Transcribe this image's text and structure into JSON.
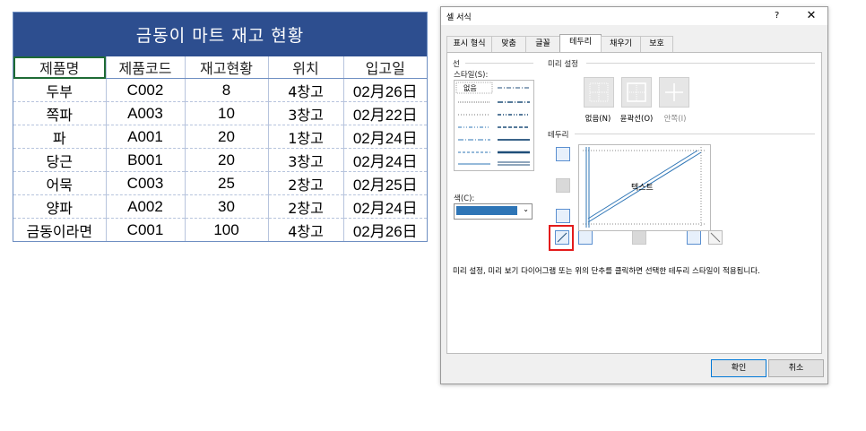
{
  "sheet": {
    "title": "금동이 마트 재고 현황",
    "headers": [
      "제품명",
      "제품코드",
      "재고현황",
      "위치",
      "입고일"
    ],
    "rows": [
      [
        "두부",
        "C002",
        "8",
        "4창고",
        "02月26日"
      ],
      [
        "쪽파",
        "A003",
        "10",
        "3창고",
        "02月22日"
      ],
      [
        "파",
        "A001",
        "20",
        "1창고",
        "02月24日"
      ],
      [
        "당근",
        "B001",
        "20",
        "3창고",
        "02月24日"
      ],
      [
        "어묵",
        "C003",
        "25",
        "2창고",
        "02月25日"
      ],
      [
        "양파",
        "A002",
        "30",
        "2창고",
        "02月24日"
      ],
      [
        "금동이라면",
        "C001",
        "100",
        "4창고",
        "02月26日"
      ]
    ],
    "header_color": "#2d4e8f"
  },
  "dialog": {
    "title": "셀 서식",
    "help": "?",
    "close": "✕",
    "tabs": [
      "표시 형식",
      "맞춤",
      "글꼴",
      "테두리",
      "채우기",
      "보호"
    ],
    "active_tab": "테두리",
    "line_group": "선",
    "style_label": "스타일(S):",
    "style_none": "없음",
    "color_label": "색(C):",
    "color_value": "#2e75b6",
    "presets_group": "미리 설정",
    "presets": [
      "없음(N)",
      "윤곽선(O)",
      "안쪽(I)"
    ],
    "border_group": "테두리",
    "preview_text": "텍스트",
    "instruction": "미리 설정, 미리 보기 다이어그램 또는 위의 단추를 클릭하면 선택한 테두리 스타일이 적용됩니다.",
    "ok": "확인",
    "cancel": "취소"
  }
}
